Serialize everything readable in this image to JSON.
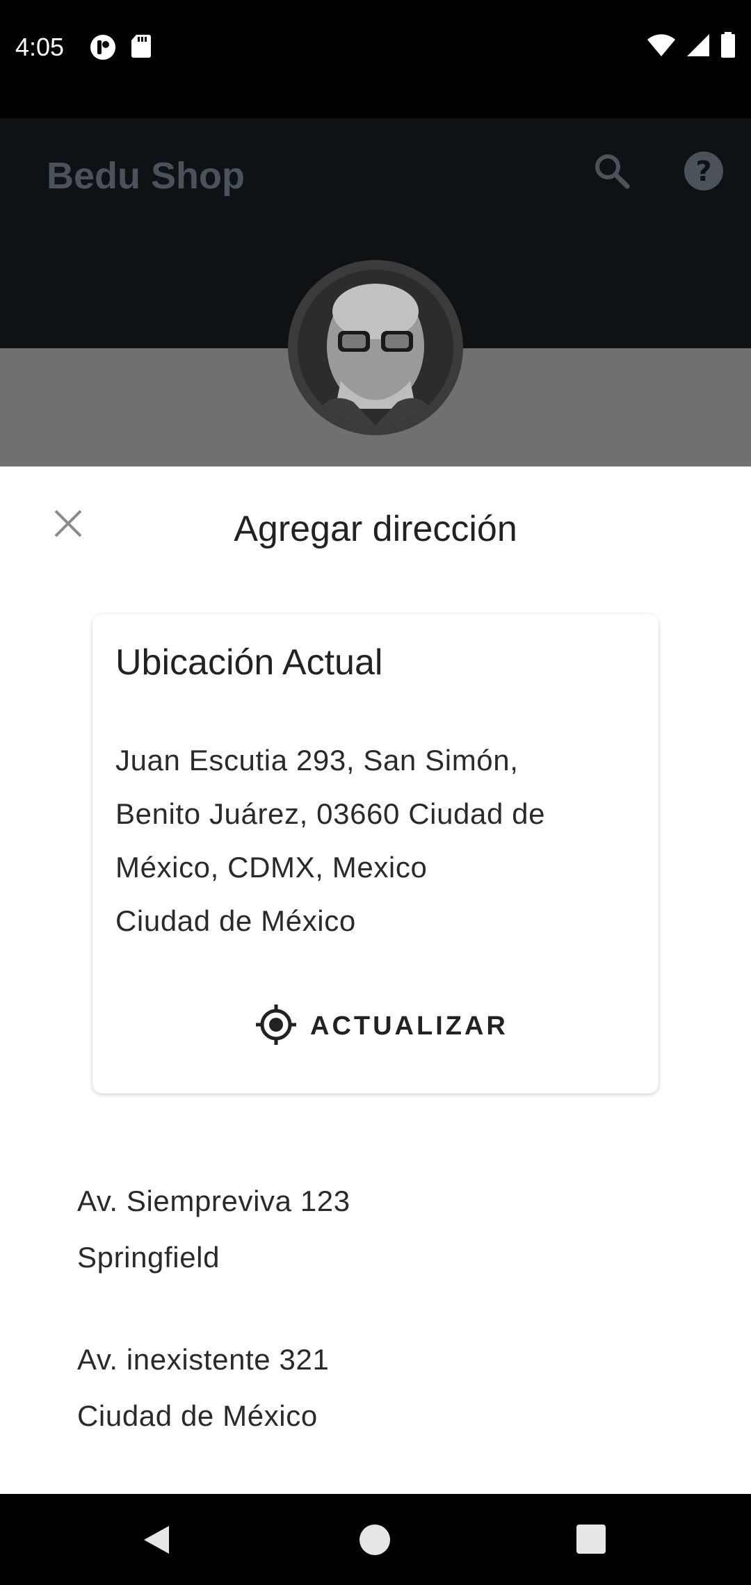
{
  "status_bar": {
    "time": "4:05",
    "icons_left": [
      "app-notification-icon",
      "sd-card-icon"
    ],
    "icons_right": [
      "wifi-icon",
      "signal-icon",
      "battery-icon"
    ]
  },
  "app_bar": {
    "title": "Bedu Shop",
    "actions": [
      "search-icon",
      "help-icon"
    ]
  },
  "sheet": {
    "title": "Agregar dirección",
    "close_icon": "close-icon",
    "current_location": {
      "title": "Ubicación Actual",
      "address_lines": [
        "Juan Escutia 293, San Simón,",
        "Benito Juárez, 03660 Ciudad de",
        "México, CDMX, Mexico",
        "Ciudad de México"
      ],
      "update_label": "ACTUALIZAR",
      "update_icon": "gps-target-icon"
    },
    "addresses": [
      {
        "street": "Av. Siempreviva 123",
        "city": "Springfield"
      },
      {
        "street": "Av. inexistente 321",
        "city": "Ciudad de México"
      }
    ]
  },
  "nav_bar": {
    "buttons": [
      "back-icon",
      "home-icon",
      "recents-icon"
    ]
  },
  "colors": {
    "status_bar": "#000000",
    "app_bar_dimmed": "#0f1215",
    "banner_dimmed": "#707070",
    "sheet_bg": "#ffffff",
    "text_primary": "#222222"
  }
}
